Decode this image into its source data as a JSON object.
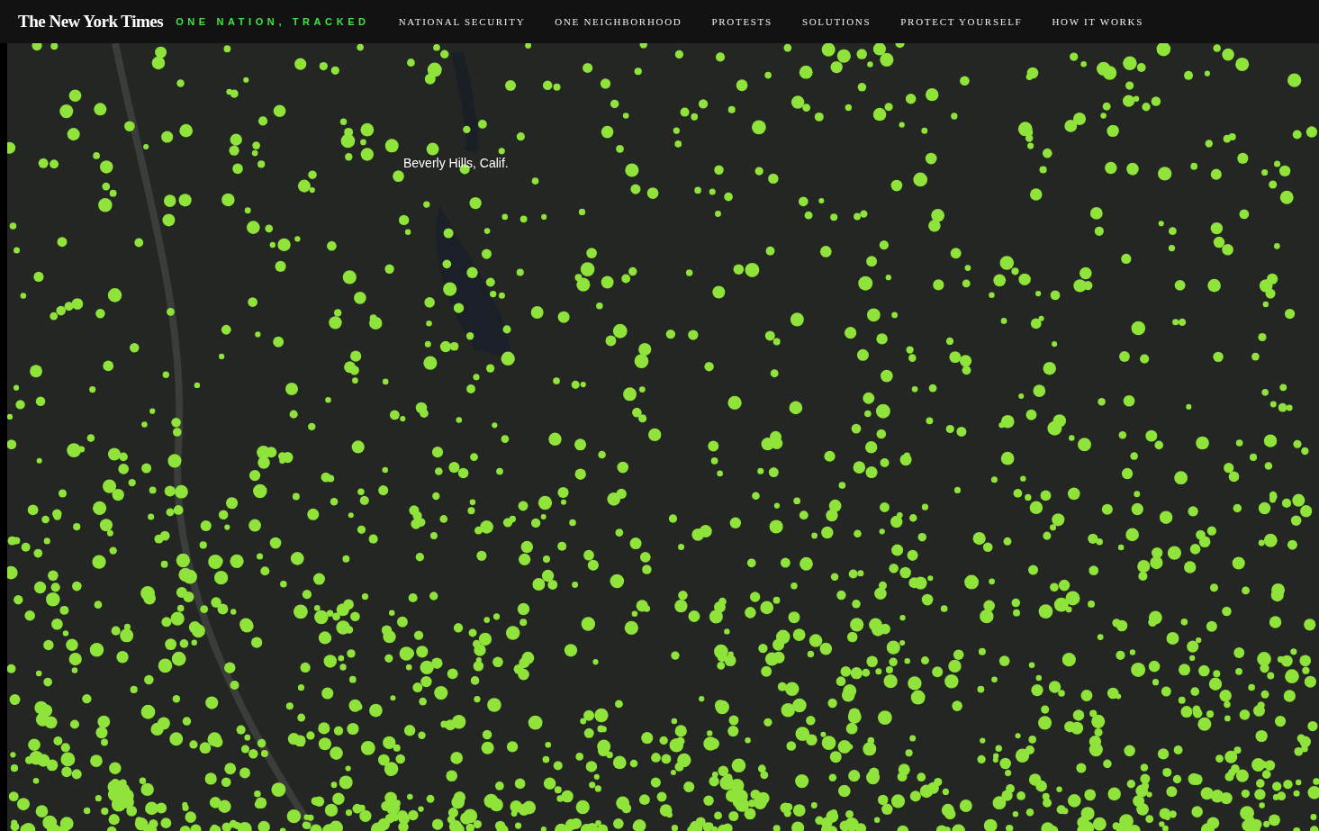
{
  "header": {
    "logo": "The New York Times",
    "series_title": "ONE NATION, TRACKED",
    "nav": [
      "NATIONAL SECURITY",
      "ONE NEIGHBORHOOD",
      "PROTESTS",
      "SOLUTIONS",
      "PROTECT YOURSELF",
      "HOW IT WORKS"
    ]
  },
  "map": {
    "place_label": "Beverly Hills, Calif."
  }
}
